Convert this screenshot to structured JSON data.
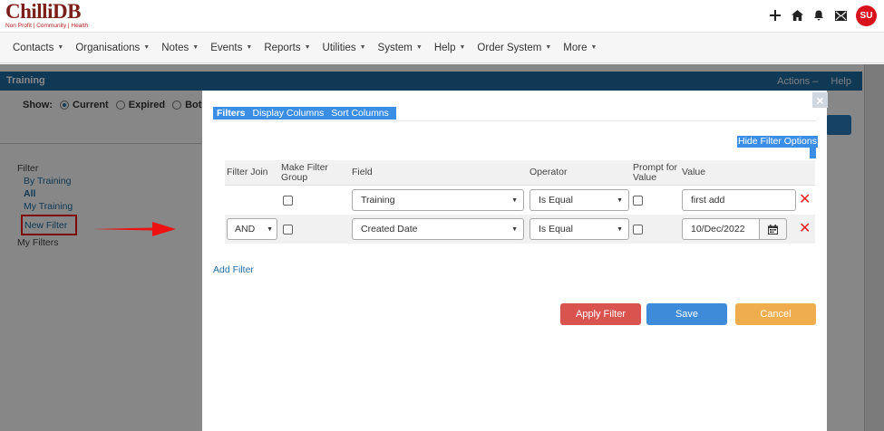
{
  "header": {
    "logo_main": "ChilliDB",
    "logo_sub": "Non Profit | Community | Health",
    "avatar_initials": "SU",
    "icons": [
      "plus-icon",
      "home-icon",
      "bell-icon",
      "mail-icon"
    ],
    "avatar_color": "#d9131e"
  },
  "nav": {
    "items": [
      {
        "label": "Contacts"
      },
      {
        "label": "Organisations"
      },
      {
        "label": "Notes"
      },
      {
        "label": "Events"
      },
      {
        "label": "Reports"
      },
      {
        "label": "Utilities"
      },
      {
        "label": "System"
      },
      {
        "label": "Help"
      },
      {
        "label": "Order System"
      },
      {
        "label": "More"
      }
    ]
  },
  "page": {
    "title": "Training",
    "actions_label": "Actions",
    "actions_sep": "–",
    "help_label": "Help",
    "show_label": "Show:",
    "show_options": [
      "Current",
      "Expired",
      "Both"
    ],
    "show_selected": "Current",
    "accent_color": "#1f6da3"
  },
  "sidebar": {
    "filter_label": "Filter",
    "links": [
      "By Training",
      "All",
      "My Training"
    ],
    "new_filter": "New Filter",
    "my_filters": "My Filters"
  },
  "modal": {
    "close_glyph": "×",
    "tabs": [
      "Filters",
      "Display Columns",
      "Sort Columns"
    ],
    "active_tab": "Filters",
    "hide_options_label": "Hide Filter Options",
    "columns": [
      "Filter Join",
      "Make Filter Group",
      "Field",
      "Operator",
      "Prompt for Value",
      "Value"
    ],
    "rows": [
      {
        "join": "",
        "field": "Training",
        "operator": "Is Equal",
        "value": "first add"
      },
      {
        "join": "AND",
        "field": "Created Date",
        "operator": "Is Equal",
        "value": "10/Dec/2022"
      }
    ],
    "add_filter_label": "Add Filter",
    "buttons": {
      "apply": "Apply Filter",
      "save": "Save",
      "cancel": "Cancel"
    },
    "button_colors": {
      "apply": "#d9534f",
      "save": "#3d8bd9",
      "cancel": "#f0ad4e"
    }
  }
}
